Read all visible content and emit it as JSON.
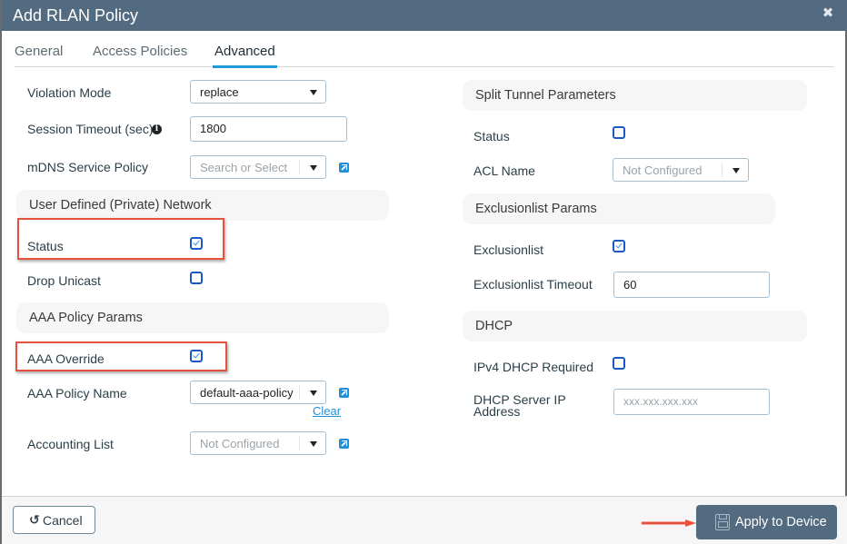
{
  "dialog": {
    "title": "Add RLAN Policy",
    "close_icon": "close-icon"
  },
  "tabs": [
    {
      "label": "General",
      "active": false
    },
    {
      "label": "Access Policies",
      "active": false
    },
    {
      "label": "Advanced",
      "active": true
    }
  ],
  "left": {
    "violation_mode": {
      "label": "Violation Mode",
      "value": "replace"
    },
    "session_timeout": {
      "label": "Session Timeout (sec)",
      "value": "1800",
      "info_icon": "info-icon"
    },
    "mdns_policy": {
      "label": "mDNS Service Policy",
      "placeholder": "Search or Select"
    },
    "udn_section": {
      "title": "User Defined (Private) Network",
      "status": {
        "label": "Status",
        "checked": true
      },
      "drop_unicast": {
        "label": "Drop Unicast",
        "checked": false
      }
    },
    "aaa_section": {
      "title": "AAA Policy Params",
      "aaa_override": {
        "label": "AAA Override",
        "checked": true
      },
      "aaa_policy_name": {
        "label": "AAA Policy Name",
        "value": "default-aaa-policy",
        "clear_label": "Clear"
      },
      "accounting_list": {
        "label": "Accounting List",
        "placeholder": "Not Configured"
      }
    }
  },
  "right": {
    "split_tunnel": {
      "title": "Split Tunnel Parameters",
      "status": {
        "label": "Status",
        "checked": false
      },
      "acl_name": {
        "label": "ACL Name",
        "placeholder": "Not Configured"
      }
    },
    "exclusionlist": {
      "title": "Exclusionlist Params",
      "exclusionlist": {
        "label": "Exclusionlist",
        "checked": true
      },
      "timeout": {
        "label": "Exclusionlist Timeout",
        "value": "60"
      }
    },
    "dhcp": {
      "title": "DHCP",
      "ipv4_required": {
        "label": "IPv4 DHCP Required",
        "checked": false
      },
      "server_ip": {
        "label_line1": "DHCP Server IP",
        "label_line2": "Address",
        "placeholder": "xxx.xxx.xxx.xxx"
      }
    }
  },
  "footer": {
    "cancel_label": "Cancel",
    "apply_label": "Apply to Device"
  },
  "colors": {
    "titlebar": "#536b80",
    "tab_active_underline": "#1e9ad6",
    "checkbox": "#1a58c4",
    "highlight_box": "#e5533e",
    "link": "#1e8fd8"
  }
}
